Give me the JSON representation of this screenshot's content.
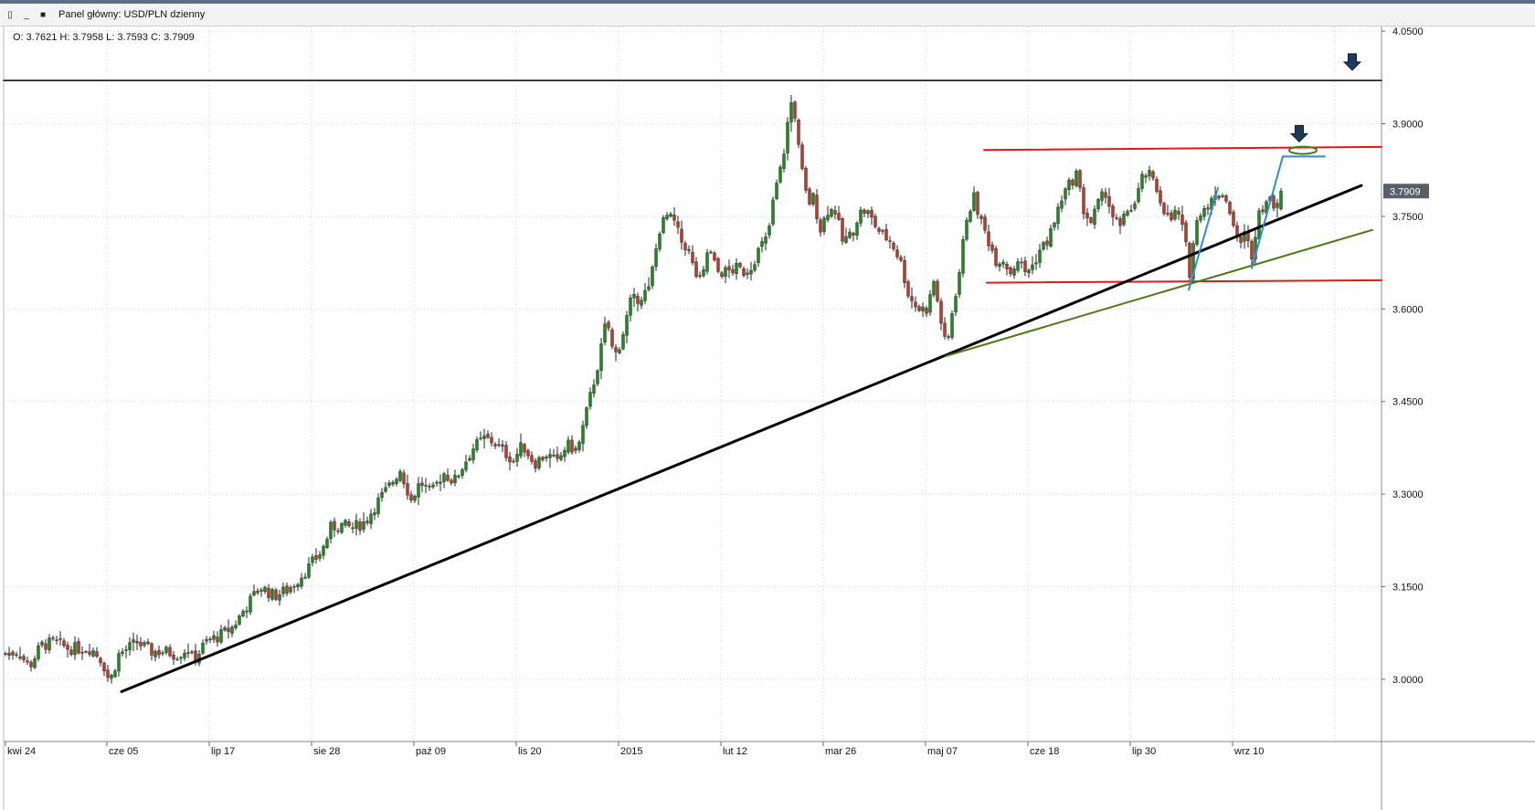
{
  "panel": {
    "title": "Panel główny: USD/PLN dzienny",
    "ohlc_readout": "O: 3.7621 H: 3.7958 L: 3.7593 C: 3.7909"
  },
  "colors": {
    "bull": "#1f8a1f",
    "bear": "#c0392b",
    "resistance": "#e0191b",
    "trend_main": "#000000",
    "trend_secondary": "#4a7a12",
    "pattern": "#2e8bd8",
    "arrow": "#1d3a5c",
    "badge": "#585f66"
  },
  "chart_data": {
    "type": "candlestick",
    "ylim": [
      2.9,
      4.06
    ],
    "y_ticks": [
      "4.0500",
      "3.9000",
      "3.7500",
      "3.6000",
      "3.4500",
      "3.3000",
      "3.1500",
      "3.0000"
    ],
    "x_ticks": [
      "kwi 24",
      "cze 05",
      "lip 17",
      "sie 28",
      "paź 09",
      "lis 20",
      "2015",
      "lut 12",
      "mar 26",
      "maj 07",
      "cze 18",
      "lip 30",
      "wrz 10"
    ],
    "last_price": "3.7909",
    "ohlc_last": {
      "open": 3.7621,
      "high": 3.7958,
      "low": 3.7593,
      "close": 3.7909
    },
    "close_path": [
      [
        0,
        3.04
      ],
      [
        20,
        3.045
      ],
      [
        32,
        3.02
      ],
      [
        45,
        3.055
      ],
      [
        60,
        3.06
      ],
      [
        75,
        3.05
      ],
      [
        88,
        3.05
      ],
      [
        100,
        3.05
      ],
      [
        112,
        3.03
      ],
      [
        120,
        2.995
      ],
      [
        130,
        3.04
      ],
      [
        140,
        3.05
      ],
      [
        150,
        3.06
      ],
      [
        165,
        3.045
      ],
      [
        180,
        3.045
      ],
      [
        195,
        3.04
      ],
      [
        205,
        3.05
      ],
      [
        212,
        3.03
      ],
      [
        225,
        3.06
      ],
      [
        240,
        3.07
      ],
      [
        255,
        3.085
      ],
      [
        268,
        3.115
      ],
      [
        285,
        3.15
      ],
      [
        300,
        3.135
      ],
      [
        315,
        3.145
      ],
      [
        325,
        3.16
      ],
      [
        340,
        3.185
      ],
      [
        353,
        3.21
      ],
      [
        362,
        3.245
      ],
      [
        372,
        3.25
      ],
      [
        385,
        3.245
      ],
      [
        400,
        3.255
      ],
      [
        412,
        3.285
      ],
      [
        425,
        3.31
      ],
      [
        438,
        3.34
      ],
      [
        450,
        3.29
      ],
      [
        460,
        3.32
      ],
      [
        472,
        3.3
      ],
      [
        485,
        3.335
      ],
      [
        497,
        3.32
      ],
      [
        508,
        3.35
      ],
      [
        518,
        3.375
      ],
      [
        530,
        3.39
      ],
      [
        540,
        3.385
      ],
      [
        550,
        3.37
      ],
      [
        562,
        3.355
      ],
      [
        572,
        3.38
      ],
      [
        585,
        3.35
      ],
      [
        598,
        3.365
      ],
      [
        610,
        3.35
      ],
      [
        620,
        3.38
      ],
      [
        632,
        3.37
      ],
      [
        640,
        3.42
      ],
      [
        648,
        3.47
      ],
      [
        656,
        3.52
      ],
      [
        664,
        3.585
      ],
      [
        672,
        3.52
      ],
      [
        680,
        3.55
      ],
      [
        690,
        3.61
      ],
      [
        700,
        3.62
      ],
      [
        710,
        3.63
      ],
      [
        716,
        3.68
      ],
      [
        722,
        3.73
      ],
      [
        730,
        3.75
      ],
      [
        738,
        3.74
      ],
      [
        745,
        3.71
      ],
      [
        752,
        3.7
      ],
      [
        760,
        3.66
      ],
      [
        768,
        3.64
      ],
      [
        775,
        3.7
      ],
      [
        785,
        3.66
      ],
      [
        795,
        3.66
      ],
      [
        806,
        3.665
      ],
      [
        815,
        3.66
      ],
      [
        822,
        3.67
      ],
      [
        832,
        3.7
      ],
      [
        840,
        3.715
      ],
      [
        848,
        3.79
      ],
      [
        856,
        3.835
      ],
      [
        862,
        3.9
      ],
      [
        868,
        3.95
      ],
      [
        872,
        3.88
      ],
      [
        878,
        3.82
      ],
      [
        884,
        3.77
      ],
      [
        890,
        3.78
      ],
      [
        898,
        3.73
      ],
      [
        906,
        3.76
      ],
      [
        914,
        3.76
      ],
      [
        922,
        3.71
      ],
      [
        932,
        3.72
      ],
      [
        940,
        3.755
      ],
      [
        948,
        3.76
      ],
      [
        956,
        3.74
      ],
      [
        965,
        3.72
      ],
      [
        975,
        3.71
      ],
      [
        985,
        3.68
      ],
      [
        995,
        3.62
      ],
      [
        1005,
        3.6
      ],
      [
        1015,
        3.6
      ],
      [
        1022,
        3.645
      ],
      [
        1030,
        3.58
      ],
      [
        1036,
        3.53
      ],
      [
        1042,
        3.595
      ],
      [
        1050,
        3.66
      ],
      [
        1058,
        3.75
      ],
      [
        1066,
        3.78
      ],
      [
        1074,
        3.74
      ],
      [
        1082,
        3.71
      ],
      [
        1090,
        3.68
      ],
      [
        1098,
        3.68
      ],
      [
        1106,
        3.66
      ],
      [
        1114,
        3.68
      ],
      [
        1122,
        3.66
      ],
      [
        1130,
        3.67
      ],
      [
        1138,
        3.695
      ],
      [
        1146,
        3.71
      ],
      [
        1154,
        3.74
      ],
      [
        1162,
        3.78
      ],
      [
        1170,
        3.8
      ],
      [
        1178,
        3.82
      ],
      [
        1186,
        3.76
      ],
      [
        1194,
        3.74
      ],
      [
        1202,
        3.77
      ],
      [
        1210,
        3.79
      ],
      [
        1218,
        3.75
      ],
      [
        1226,
        3.73
      ],
      [
        1234,
        3.76
      ],
      [
        1242,
        3.77
      ],
      [
        1250,
        3.81
      ],
      [
        1256,
        3.82
      ],
      [
        1264,
        3.8
      ],
      [
        1272,
        3.77
      ],
      [
        1280,
        3.74
      ],
      [
        1288,
        3.76
      ],
      [
        1296,
        3.72
      ],
      [
        1302,
        3.66
      ],
      [
        1308,
        3.73
      ],
      [
        1314,
        3.76
      ],
      [
        1322,
        3.77
      ],
      [
        1330,
        3.78
      ],
      [
        1338,
        3.79
      ],
      [
        1346,
        3.76
      ],
      [
        1354,
        3.71
      ],
      [
        1362,
        3.72
      ],
      [
        1370,
        3.69
      ],
      [
        1378,
        3.76
      ],
      [
        1386,
        3.775
      ],
      [
        1394,
        3.77
      ],
      [
        1402,
        3.7909
      ]
    ],
    "lines": [
      {
        "name": "resistance-top",
        "color": "#e0191b",
        "points": [
          [
            1077,
            3.8575
          ],
          [
            1512,
            3.8625
          ]
        ]
      },
      {
        "name": "resistance-bottom",
        "color": "#e0191b",
        "points": [
          [
            1080,
            3.6425
          ],
          [
            1512,
            3.6465
          ]
        ]
      },
      {
        "name": "horizontal-high",
        "color": "#000000",
        "points": [
          [
            4,
            3.97
          ],
          [
            1512,
            3.97
          ]
        ]
      },
      {
        "name": "trend-main",
        "color": "#000000",
        "points": [
          [
            133,
            2.98
          ],
          [
            1490,
            3.8
          ]
        ]
      },
      {
        "name": "trend-secondary",
        "color": "#4a7a12",
        "points": [
          [
            1036,
            3.524
          ],
          [
            1502,
            3.728
          ]
        ]
      },
      {
        "name": "pattern-leg-1",
        "color": "#2e8bd8",
        "points": [
          [
            1301,
            3.631
          ],
          [
            1333,
            3.796
          ]
        ]
      },
      {
        "name": "pattern-leg-2",
        "color": "#2e8bd8",
        "points": [
          [
            1370,
            3.666
          ],
          [
            1404,
            3.847
          ]
        ]
      },
      {
        "name": "pattern-target",
        "color": "#2e8bd8",
        "points": [
          [
            1404,
            3.847
          ],
          [
            1450,
            3.847
          ]
        ]
      }
    ],
    "markers": [
      {
        "name": "target-ellipse",
        "type": "ellipse",
        "x": 1426,
        "y": 3.857,
        "color": "#4a7a12"
      },
      {
        "name": "arrow-top-right",
        "type": "arrow",
        "x": 1480,
        "y": 4.0
      },
      {
        "name": "arrow-target",
        "type": "arrow",
        "x": 1422,
        "y": 3.884
      }
    ]
  }
}
